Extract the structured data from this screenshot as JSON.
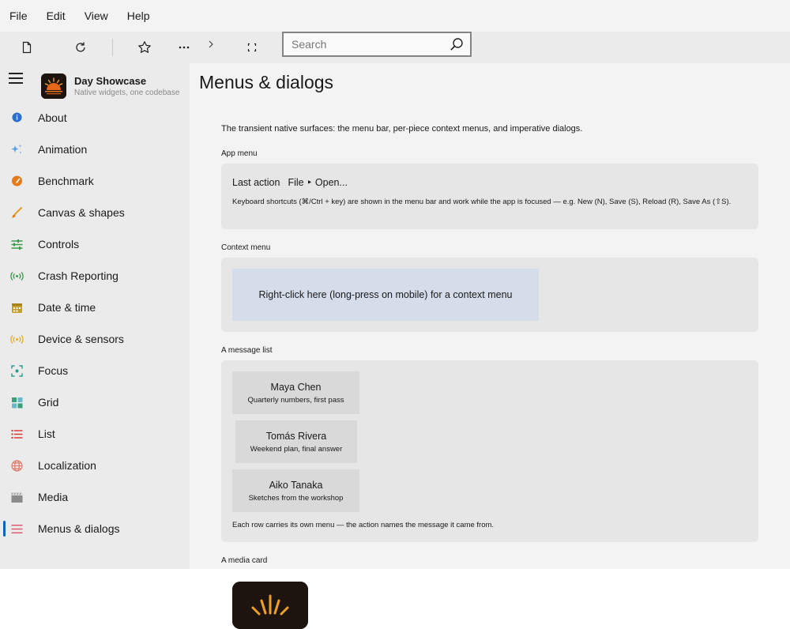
{
  "menubar": {
    "items": [
      "File",
      "Edit",
      "View",
      "Help"
    ]
  },
  "toolbar": {
    "icons": [
      "new-page-icon",
      "reload-icon",
      "star-icon",
      "more-icon",
      "chevron-right-icon",
      "fullscreen-icon"
    ],
    "search_placeholder": "Search"
  },
  "sidebar": {
    "app_title": "Day Showcase",
    "app_subtitle": "Native widgets, one codebase",
    "items": [
      {
        "label": "About",
        "icon": "info-icon",
        "color": "#2c6fd1"
      },
      {
        "label": "Animation",
        "icon": "sparkle-icon",
        "color": "#5aa0e6"
      },
      {
        "label": "Benchmark",
        "icon": "gauge-icon",
        "color": "#e77a18"
      },
      {
        "label": "Canvas & shapes",
        "icon": "brush-icon",
        "color": "#e0a030"
      },
      {
        "label": "Controls",
        "icon": "sliders-icon",
        "color": "#3a9a4a"
      },
      {
        "label": "Crash Reporting",
        "icon": "broadcast-icon",
        "color": "#3a9a4a"
      },
      {
        "label": "Date & time",
        "icon": "calendar-icon",
        "color": "#c8a028"
      },
      {
        "label": "Device & sensors",
        "icon": "sensor-icon",
        "color": "#e0b020"
      },
      {
        "label": "Focus",
        "icon": "focus-icon",
        "color": "#2a9a8a"
      },
      {
        "label": "Grid",
        "icon": "grid-icon",
        "color": "#3aa07a"
      },
      {
        "label": "List",
        "icon": "list-icon",
        "color": "#d83030"
      },
      {
        "label": "Localization",
        "icon": "globe-icon",
        "color": "#e07a6a"
      },
      {
        "label": "Media",
        "icon": "clapper-icon",
        "color": "#8a8a8a"
      },
      {
        "label": "Menus & dialogs",
        "icon": "menu-lines-icon",
        "color": "#e0506a"
      }
    ],
    "selected": "Menus & dialogs"
  },
  "main": {
    "title": "Menus & dialogs",
    "intro": "The transient native surfaces: the menu bar, per-piece context menus, and imperative dialogs.",
    "app_menu": {
      "label": "App menu",
      "last_action_label": "Last action",
      "last_action_value": "File ‣ Open...",
      "note": "Keyboard shortcuts (⌘/Ctrl + key) are shown in the menu bar and work while the app is focused — e.g. New (N), Save (S), Reload (R), Save As (⇧S)."
    },
    "context_menu": {
      "label": "Context menu",
      "area_text": "Right-click here (long-press on mobile) for a context menu"
    },
    "message_list": {
      "label": "A message list",
      "messages": [
        {
          "name": "Maya Chen",
          "subject": "Quarterly numbers, first pass"
        },
        {
          "name": "Tomás Rivera",
          "subject": "Weekend plan, final answer"
        },
        {
          "name": "Aiko Tanaka",
          "subject": "Sketches from the workshop"
        }
      ],
      "note": "Each row carries its own menu — the action names the message it came from."
    },
    "media_card": {
      "label": "A media card"
    }
  }
}
